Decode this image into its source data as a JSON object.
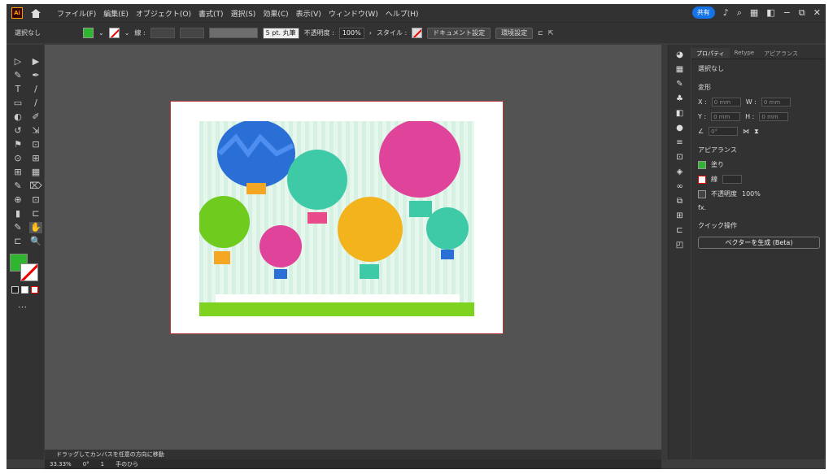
{
  "app": {
    "logo": "Ai",
    "home_icon": "home-icon"
  },
  "menu": [
    "ファイル(F)",
    "編集(E)",
    "オブジェクト(O)",
    "書式(T)",
    "選択(S)",
    "効果(C)",
    "表示(V)",
    "ウィンドウ(W)",
    "ヘルプ(H)"
  ],
  "header_right": {
    "share_label": "共有",
    "icons": [
      "bell-icon",
      "search-icon",
      "workspace-icon",
      "arrange-icon"
    ],
    "window_controls": [
      "−",
      "⧉",
      "✕"
    ]
  },
  "options": {
    "selection": "選択なし",
    "fill_color": "#2fb52f",
    "stroke_label": "線 :",
    "stroke_profile": "5 pt. 丸筆",
    "opacity_label": "不透明度 :",
    "opacity_value": "100%",
    "style_label": "スタイル :",
    "doc_setup": "ドキュメント設定",
    "preferences": "環境設定"
  },
  "tools": [
    "▷",
    "▶",
    "✎",
    "✒",
    "T",
    "/",
    "▭",
    "/",
    "◐",
    "✐",
    "↺",
    "⇲",
    "⚑",
    "⊡",
    "⊙",
    "⊞",
    "⊞",
    "▦",
    "✎",
    "⌦",
    "⊕",
    "⊡",
    "▮",
    "⊏",
    "✎",
    "✋",
    "⊏",
    "🔍"
  ],
  "panel": {
    "tabs": [
      "プロパティ",
      "Retype",
      "アピアランス"
    ],
    "selection": "選択なし",
    "transform_title": "変形",
    "x_label": "X :",
    "y_label": "Y :",
    "w_label": "W :",
    "h_label": "H :",
    "x_placeholder": "0 mm",
    "y_placeholder": "0 mm",
    "w_placeholder": "0 mm",
    "h_placeholder": "0 mm",
    "angle_placeholder": "0°",
    "appearance_title": "アピアランス",
    "fill_label": "塗り",
    "stroke_label": "線",
    "opacity_label": "不透明度",
    "opacity_value": "100%",
    "fx": "fx.",
    "quick_title": "クイック操作",
    "vectorize_btn": "ベクターを生成 (Beta)"
  },
  "hint": "ドラッグしてカンバスを任意の方向に移動",
  "status": {
    "zoom": "33.33%",
    "rotation": "0°",
    "artboard": "1",
    "tool": "手のひら"
  },
  "colors": {
    "accent": "#1473e6",
    "fill": "#2fb52f",
    "stroke": "#e00000"
  }
}
